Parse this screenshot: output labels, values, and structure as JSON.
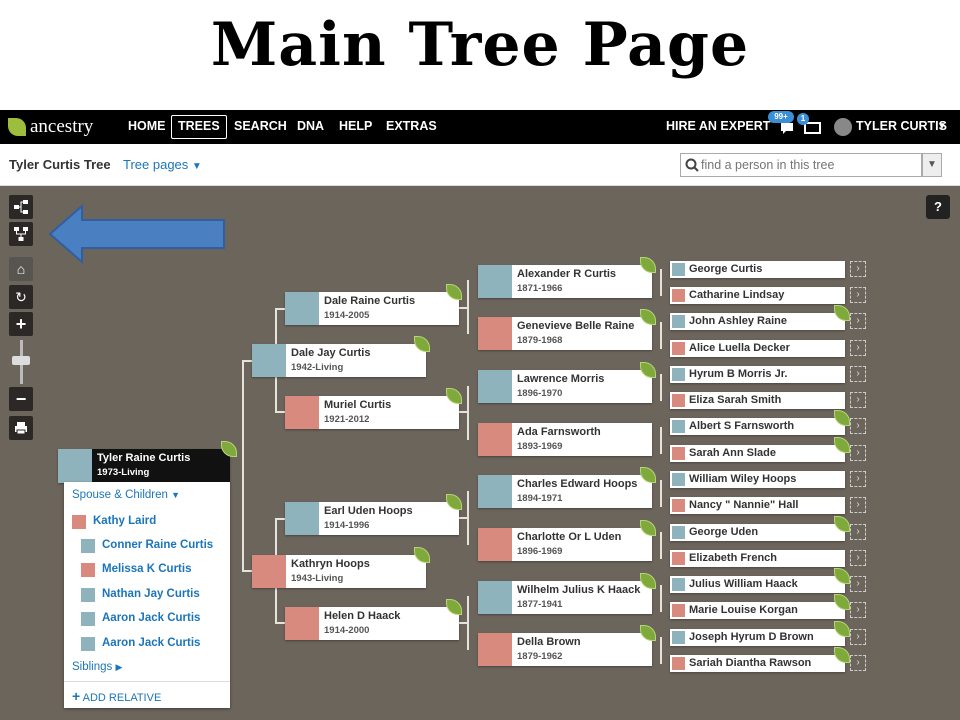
{
  "slide": {
    "title": "Main Tree Page"
  },
  "nav": {
    "logo": "ancestry",
    "items": [
      "HOME",
      "TREES",
      "SEARCH",
      "DNA",
      "HELP",
      "EXTRAS"
    ],
    "active": "TREES",
    "hire_expert": "HIRE AN EXPERT",
    "notifications_badge": "99+",
    "messages_badge": "1",
    "user_name": "TYLER CURTIS"
  },
  "subbar": {
    "tree_name": "Tyler Curtis Tree",
    "tree_pages": "Tree pages",
    "search_placeholder": "find a person in this tree"
  },
  "toolbar": {
    "pedigree_view": "pedigree-view-icon",
    "family_view": "family-view-icon",
    "home": "home-icon",
    "reset": "refresh-icon",
    "zoom_in": "+",
    "zoom_out": "−",
    "print": "print-icon",
    "help": "?"
  },
  "root_person": {
    "name": "Tyler Raine Curtis",
    "dates": "1973-Living"
  },
  "panel": {
    "spouse_children": "Spouse & Children",
    "spouse": "Kathy Laird",
    "children": [
      "Conner Raine Curtis",
      "Melissa K Curtis",
      "Nathan Jay Curtis",
      "Aaron Jack Curtis",
      "Aaron Jack Curtis"
    ],
    "siblings": "Siblings",
    "add_relative": "ADD RELATIVE"
  },
  "parents": [
    {
      "name": "Dale Jay Curtis",
      "dates": "1942-Living"
    },
    {
      "name": "Kathryn Hoops",
      "dates": "1943-Living"
    }
  ],
  "grandparents": [
    {
      "name": "Dale Raine Curtis",
      "dates": "1914-2005"
    },
    {
      "name": "Muriel Curtis",
      "dates": "1921-2012"
    },
    {
      "name": "Earl Uden Hoops",
      "dates": "1914-1996"
    },
    {
      "name": "Helen D Haack",
      "dates": "1914-2000"
    }
  ],
  "great_grandparents": [
    {
      "name": "Alexander R Curtis",
      "dates": "1871-1966"
    },
    {
      "name": "Genevieve Belle Raine",
      "dates": "1879-1968"
    },
    {
      "name": "Lawrence Morris",
      "dates": "1896-1970"
    },
    {
      "name": "Ada Farnsworth",
      "dates": "1893-1969"
    },
    {
      "name": "Charles Edward Hoops",
      "dates": "1894-1971"
    },
    {
      "name": "Charlotte Or L Uden",
      "dates": "1896-1969"
    },
    {
      "name": "Wilhelm Julius K Haack",
      "dates": "1877-1941"
    },
    {
      "name": "Della Brown",
      "dates": "1879-1962"
    }
  ],
  "gg_grandparents": [
    "George Curtis",
    "Catharine Lindsay",
    "John Ashley Raine",
    "Alice Luella Decker",
    "Hyrum B Morris Jr.",
    "Eliza Sarah Smith",
    "Albert S Farnsworth",
    "Sarah Ann Slade",
    "William Wiley Hoops",
    "Nancy \" Nannie\" Hall",
    "George Uden",
    "Elizabeth French",
    "Julius William Haack",
    "Marie Louise Korgan",
    "Joseph Hyrum D Brown",
    "Sariah Diantha Rawson"
  ],
  "colors": {
    "canvas": "#6c655c",
    "male_avatar": "#8fb3bd",
    "female_avatar": "#d88a7f",
    "leaf_hint": "#7fa93a",
    "link": "#1b75bb",
    "annotation_arrow": "#4a7fc1"
  }
}
